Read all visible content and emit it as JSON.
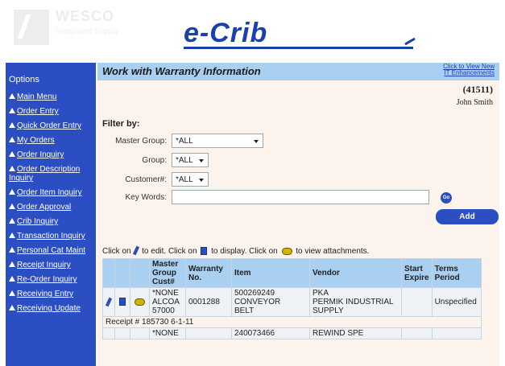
{
  "header": {
    "logo_text": "WESCO",
    "logo_sub": "Integrated Supply",
    "app_title": "e-Crib"
  },
  "sidebar": {
    "title": "Options",
    "items": [
      {
        "label": "Main Menu"
      },
      {
        "label": "Order Entry"
      },
      {
        "label": "Quick Order Entry"
      },
      {
        "label": "My Orders"
      },
      {
        "label": "Order Inquiry"
      },
      {
        "label": "Order Description Inquiry"
      },
      {
        "label": "Order Item Inquiry"
      },
      {
        "label": "Order Approval"
      },
      {
        "label": "Crib Inquiry"
      },
      {
        "label": "Transaction Inquiry"
      },
      {
        "label": "Personal Cat Maint"
      },
      {
        "label": "Receipt Inquiry"
      },
      {
        "label": "Re-Order Inquiry"
      },
      {
        "label": "Receiving Entry"
      },
      {
        "label": "Receiving Update"
      }
    ]
  },
  "page": {
    "title": "Work with Warranty Information",
    "enhancements_link": [
      "Click to View New",
      "IT Enhancements"
    ],
    "user_id": "(41511)",
    "user_name": "John Smith"
  },
  "filter": {
    "label": "Filter by:",
    "master_group_label": "Master Group:",
    "master_group_value": "*ALL",
    "group_label": "Group:",
    "group_value": "*ALL",
    "customer_label": "Customer#:",
    "customer_value": "*ALL",
    "keywords_label": "Key Words:",
    "keywords_value": "",
    "go_label": "Go",
    "add_label": "Add"
  },
  "instructions": {
    "part1": "Click on",
    "part2": "to edit. Click on",
    "part3": "to display. Click on",
    "part4": "to view attachments."
  },
  "table": {
    "headers": {
      "master": [
        "Master",
        "Group",
        "Cust#"
      ],
      "warranty": [
        "Warranty",
        "No."
      ],
      "item": "Item",
      "vendor": "Vendor",
      "start": [
        "Start",
        "Expire"
      ],
      "terms": [
        "Terms",
        "Period"
      ]
    },
    "rows": [
      {
        "master": [
          "*NONE",
          "ALCOA",
          "57000"
        ],
        "warranty": "0001288",
        "item": [
          "500269249",
          "CONVEYOR",
          "BELT"
        ],
        "vendor": [
          "PKA",
          "PERMIK INDUSTRIAL",
          "SUPPLY"
        ],
        "start": "",
        "terms": "Unspecified"
      }
    ],
    "receipt": "Receipt # 185730 6-1-11",
    "partial_row": {
      "master": "*NONE",
      "item": "240073466",
      "vendor": "REWIND SPE"
    }
  },
  "colors": {
    "accent": "#2b4fc3",
    "header_bar": "#a9d0f0",
    "content_bg": "#fbf3ec"
  }
}
